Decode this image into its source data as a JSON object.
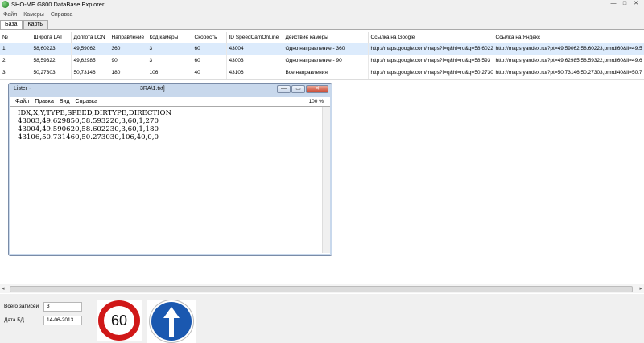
{
  "window": {
    "title": "SHO-ME G800 DataBase Explorer",
    "min": "—",
    "max": "□",
    "close": "✕"
  },
  "menu": [
    "Файл",
    "Камеры",
    "Справка"
  ],
  "tabs": [
    "База",
    "Карты"
  ],
  "table": {
    "columns": [
      "№",
      "Широта LAT",
      "Долгота LON",
      "Направление",
      "Код камеры",
      "Скорость",
      "ID SpeedCamOnLine",
      "Действие камеры",
      "Ссылка на Google",
      "Ссылка на Яндекс"
    ],
    "rows": [
      [
        "1",
        "58,60223",
        "49,59062",
        "360",
        "3",
        "60",
        "43004",
        "Одно направление - 360",
        "http://maps.google.com/maps?f=q&hl=ru&q=58.6022",
        "http://maps.yandex.ru/?pt=49.59062,58.60223,pmrdl60&ll=49.5"
      ],
      [
        "2",
        "58,59322",
        "49,62985",
        "90",
        "3",
        "60",
        "43003",
        "Одно направление - 90",
        "http://maps.google.com/maps?f=q&hl=ru&q=58.593",
        "http://maps.yandex.ru/?pt=49.62985,58.59322,pmrdl60&ll=49.6"
      ],
      [
        "3",
        "50,27303",
        "50,73146",
        "180",
        "106",
        "40",
        "43106",
        "Все направления",
        "http://maps.google.com/maps?f=q&hl=ru&q=50.2730",
        "http://maps.yandex.ru/?pt=50.73146,50.27303,pmrdl40&ll=50.7"
      ]
    ],
    "selected_row": 0
  },
  "lister": {
    "title": "Lister -",
    "path": "3RA\\1.txt]",
    "menu": [
      "Файл",
      "Правка",
      "Вид",
      "Справка"
    ],
    "zoom": "100 %",
    "content": "IDX,X,Y,TYPE,SPEED,DIRTYPE,DIRECTION\n43003,49.629850,58.593220,3,60,1,270\n43004,49.590620,58.602230,3,60,1,180\n43106,50.731460,50.273030,106,40,0,0"
  },
  "status": {
    "records_label": "Всего записей",
    "records_value": "3",
    "date_label": "Дата БД",
    "date_value": "14-06-2013"
  },
  "signs": {
    "speed_limit": "60",
    "arrow_icon": "straight-arrow-icon"
  },
  "colors": {
    "selection": "#dcebfc",
    "sign_red": "#d01818",
    "sign_blue": "#1a58b0"
  }
}
